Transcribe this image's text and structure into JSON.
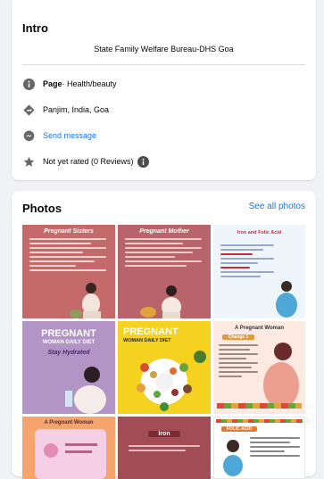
{
  "intro": {
    "title": "Intro",
    "bio": "State Family Welfare Bureau-DHS Goa",
    "category_prefix": "Page",
    "category_value": " · Health/beauty",
    "location": "Panjim, India, Goa",
    "message_label": "Send message",
    "rating": "Not yet rated (0 Reviews)"
  },
  "photos": {
    "title": "Photos",
    "see_all_label": "See all photos",
    "items": [
      {
        "heading": "Pregnant Sisters",
        "bg": "#c56a6b"
      },
      {
        "heading": "Pregnant Mother",
        "bg": "#b9646a"
      },
      {
        "heading": "Iron and Folic Acid",
        "bg": "#eef6fb"
      },
      {
        "heading": "PREGNANT",
        "sub": "WOMAN DAILY DIET",
        "tag": "Stay Hydrated",
        "bg": "#b294c7"
      },
      {
        "heading": "PREGNANT",
        "sub": "WOMAN DAILY DIET",
        "bg": "#f4d21f"
      },
      {
        "heading": "A Pregnant Woman",
        "tag": "Change 1",
        "bg": "#fbe9e2"
      },
      {
        "heading": "A Pregnant Woman",
        "bg": "#f6a46e"
      },
      {
        "heading": "Iron",
        "bg": "#a24d56"
      },
      {
        "heading": "FOLIC ACID",
        "bg": "#ffffff"
      }
    ]
  },
  "colors": {
    "page_bg": "#f0f2f5",
    "card_bg": "#ffffff",
    "link": "#1b74e4",
    "icon": "#65676b"
  },
  "icons": [
    "info-icon",
    "location-icon",
    "messenger-icon",
    "star-icon",
    "rating-info-icon"
  ]
}
